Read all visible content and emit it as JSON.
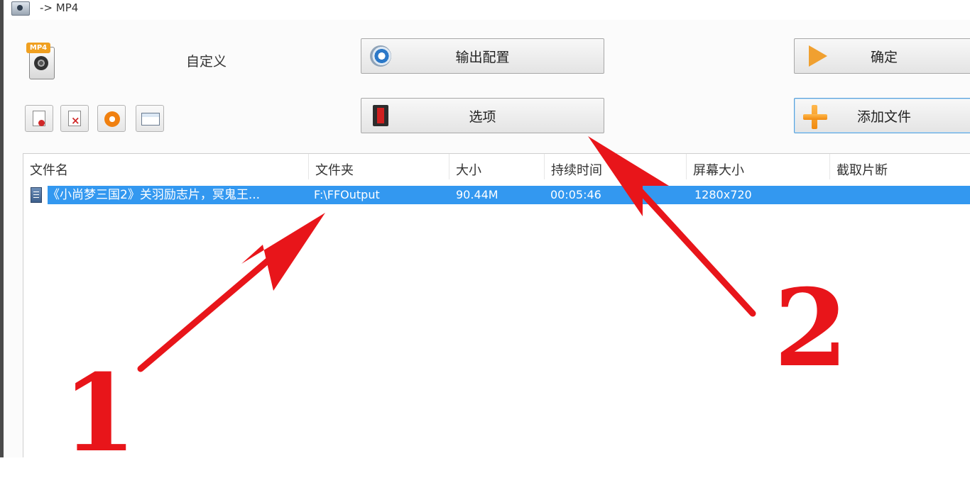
{
  "window": {
    "title": "-> MP4"
  },
  "profile": {
    "label": "自定义"
  },
  "buttons": {
    "output_config": "输出配置",
    "options": "选项",
    "ok": "确定",
    "add_file": "添加文件"
  },
  "toolbar": {
    "icons": [
      "add-file-icon",
      "remove-file-icon",
      "play-icon",
      "media-info-icon"
    ]
  },
  "file_list": {
    "columns": [
      "文件名",
      "文件夹",
      "大小",
      "持续时间",
      "屏幕大小",
      "截取片断"
    ],
    "rows": [
      {
        "name": "《小尚梦三国2》关羽励志片，冥鬼王...",
        "folder": "F:\\FFOutput",
        "size": "90.44M",
        "duration": "00:05:46",
        "screen_size": "1280x720",
        "clip": ""
      }
    ]
  },
  "annotations": {
    "arrow_1_label": "1",
    "arrow_2_label": "2",
    "color": "#e8151a"
  },
  "colors": {
    "selection": "#3398f0",
    "accent_orange": "#f0a030"
  }
}
